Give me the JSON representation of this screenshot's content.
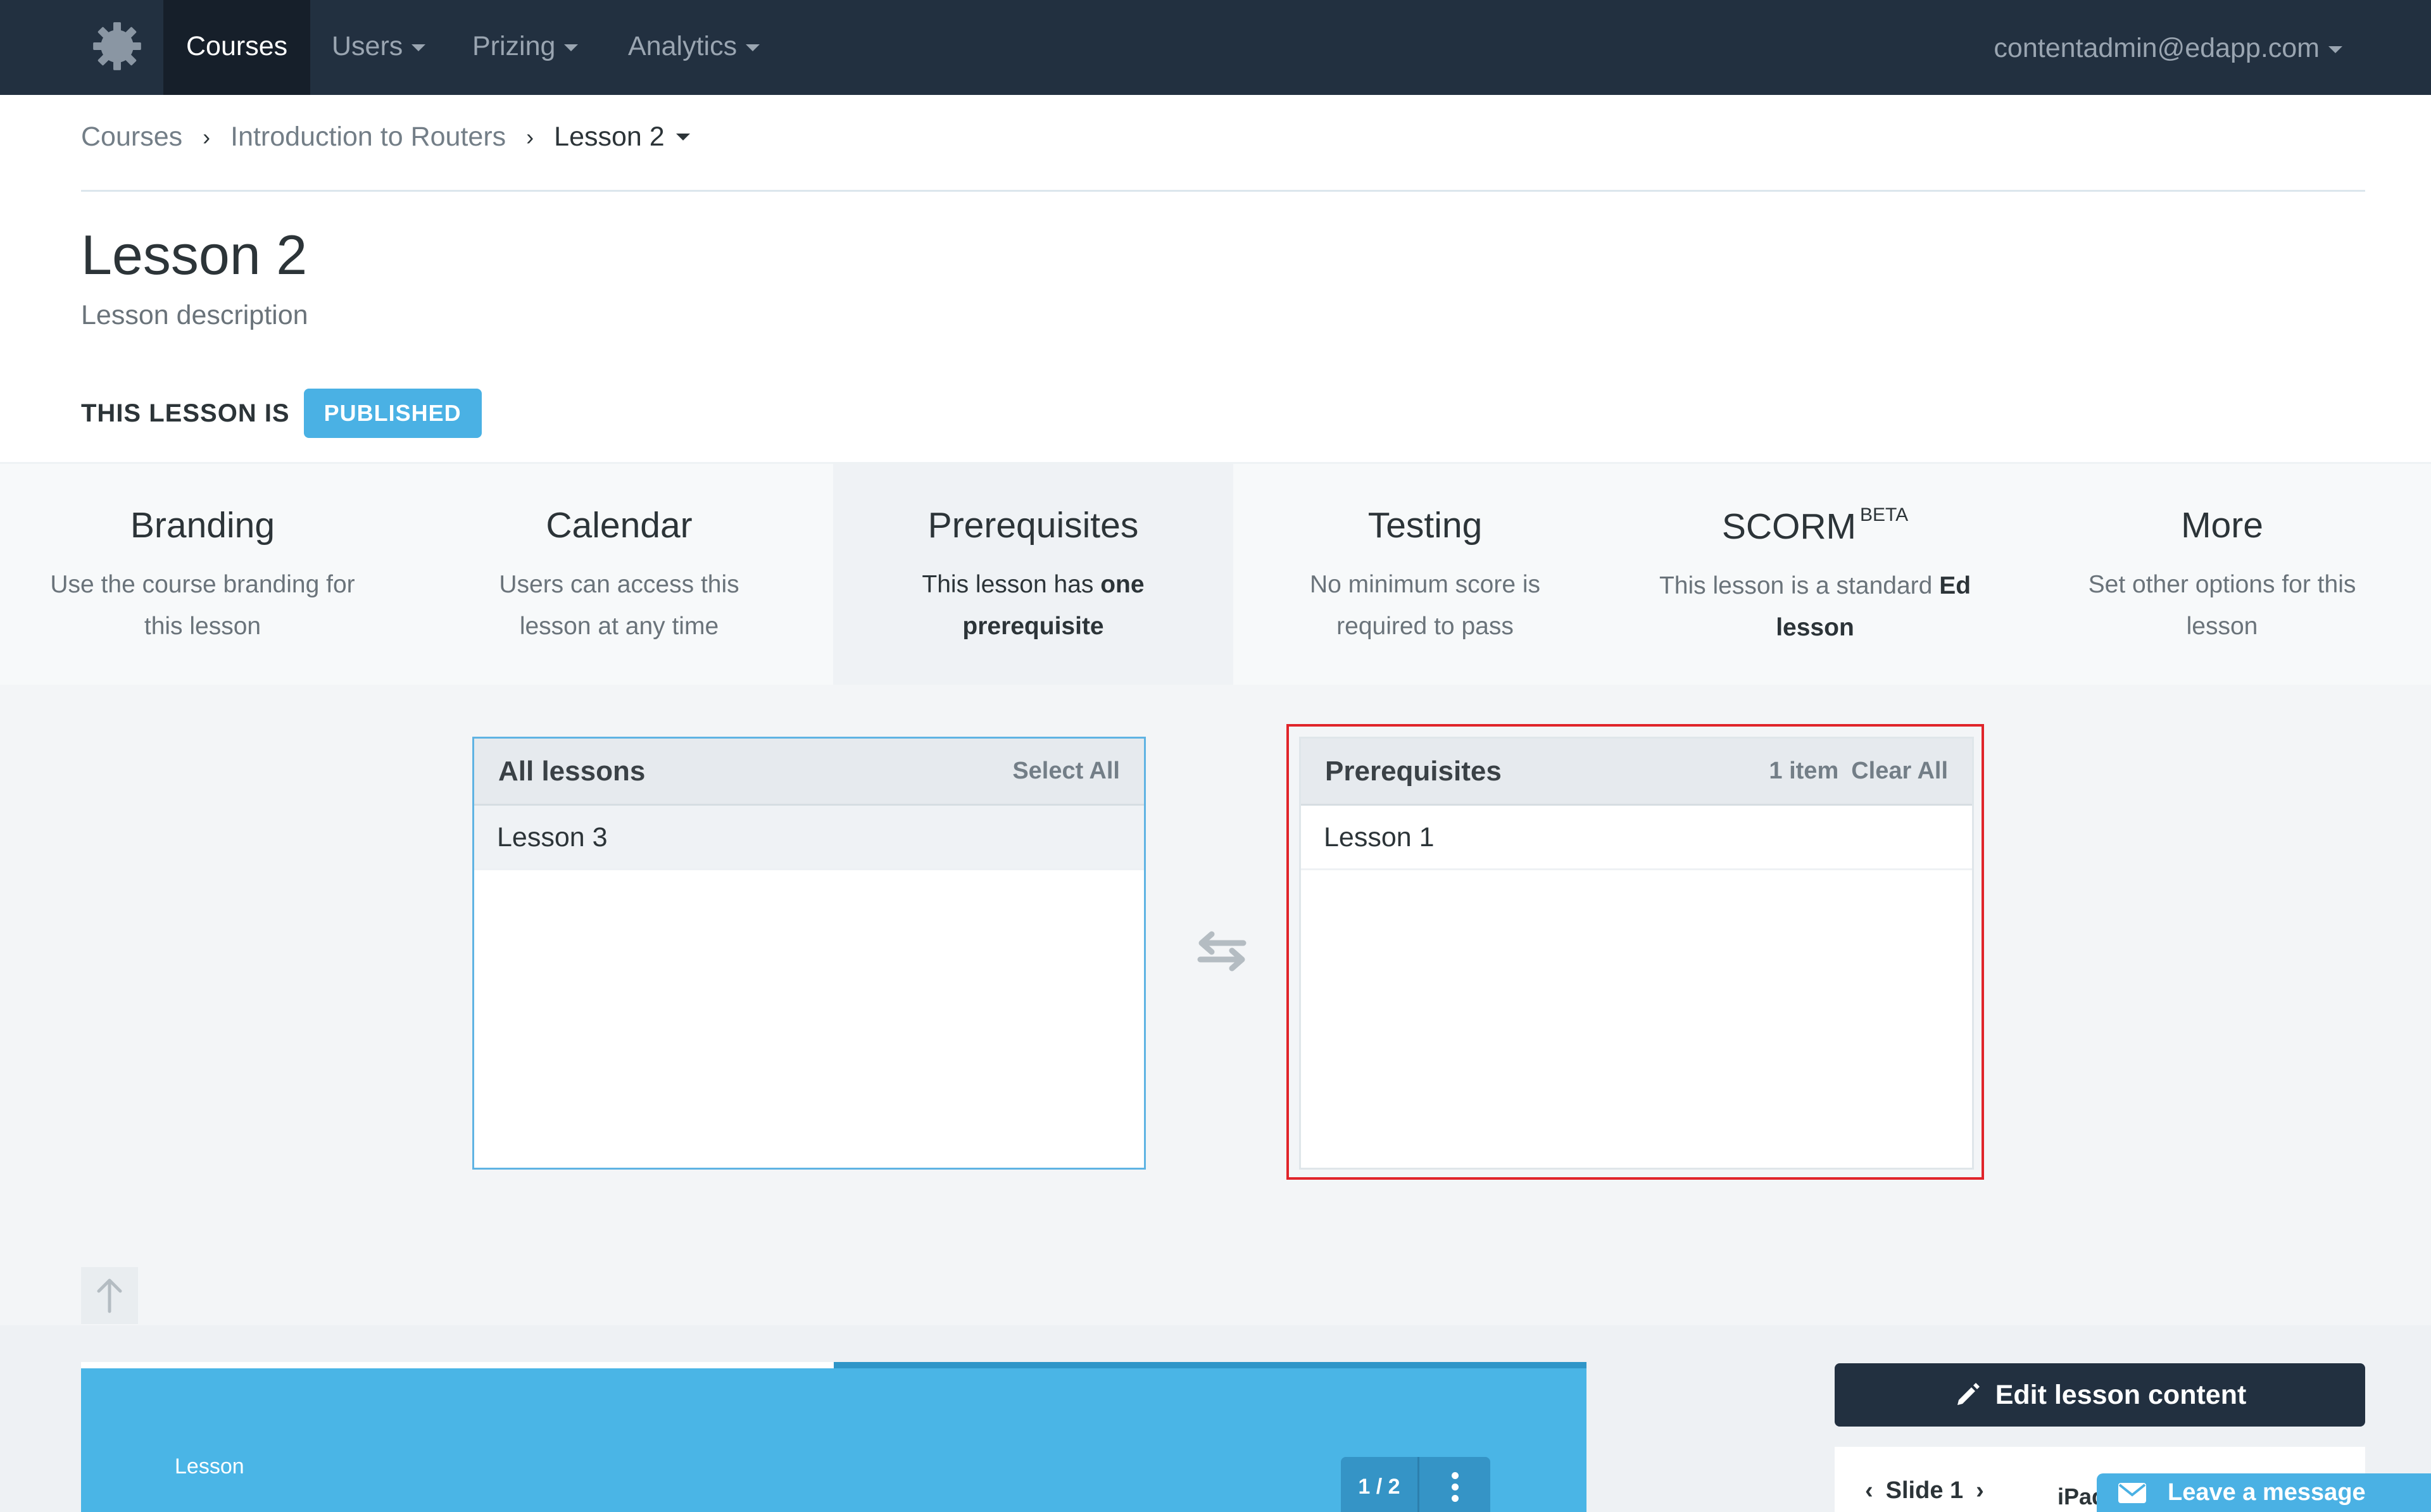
{
  "nav": {
    "logo_icon": "gear-icon",
    "items": [
      {
        "label": "Courses",
        "active": true
      },
      {
        "label": "Users",
        "dropdown": true
      },
      {
        "label": "Prizing",
        "dropdown": true
      },
      {
        "label": "Analytics",
        "dropdown": true
      }
    ],
    "user_email": "contentadmin@edapp.com"
  },
  "breadcrumb": [
    "Courses",
    "Introduction to Routers",
    "Lesson 2"
  ],
  "lesson": {
    "title": "Lesson 2",
    "description": "Lesson description",
    "status_label": "THIS LESSON IS",
    "status_badge": "PUBLISHED"
  },
  "tabs": [
    {
      "title": "Branding",
      "desc": "Use the course branding for this lesson"
    },
    {
      "title": "Calendar",
      "desc": "Users can access this lesson at any time"
    },
    {
      "title": "Prerequisites",
      "desc_prefix": "This lesson has",
      "desc_bold": "one prerequisite",
      "active": true
    },
    {
      "title": "Testing",
      "desc": "No minimum score is required to pass"
    },
    {
      "title": "SCORM",
      "sup": "BETA",
      "desc_prefix": "This lesson is a standard",
      "desc_bold": "Ed lesson"
    },
    {
      "title": "More",
      "desc": "Set other options for this lesson"
    }
  ],
  "all_lessons": {
    "title": "All lessons",
    "action": "Select All",
    "items": [
      "Lesson 3"
    ]
  },
  "prerequisites": {
    "title": "Prerequisites",
    "count": "1 item",
    "action": "Clear All",
    "items": [
      "Lesson 1"
    ]
  },
  "preview": {
    "label": "Lesson",
    "pager": "1 / 2",
    "progress": 0.5
  },
  "edit_button": "Edit lesson content",
  "slide_nav": {
    "label": "Slide 1",
    "device": "iPad"
  },
  "chat": {
    "label": "Leave a message"
  },
  "colors": {
    "nav_bg": "#223040",
    "accent": "#4ab1e4",
    "highlight": "#e0242a"
  }
}
